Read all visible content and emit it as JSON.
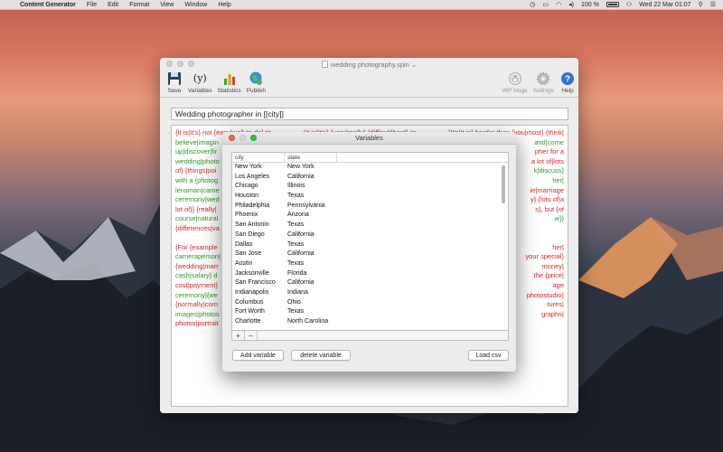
{
  "menubar": {
    "app_name": "Content Generator",
    "items": [
      "File",
      "Edit",
      "Format",
      "View",
      "Window",
      "Help"
    ],
    "battery": "100 %",
    "clock": "Wed 22 Mar  01:07"
  },
  "main_window": {
    "title": "wedding photography.spin",
    "toolbar": {
      "save": "Save",
      "variables_icon": "(y)",
      "variables": "Variables",
      "statistics": "Statistics",
      "publish": "Publish",
      "wp_blogs": "WP blogs",
      "settings": "Settings",
      "help": "Help"
    },
    "title_field_value": "Wedding photographer in [[city]]",
    "editor_lines": [
      [
        [
          "{It is|It's} not {easy|well-to-do} to",
          "r"
        ],
        [
          "(It is|It's} {very|really} {difficult|hard} to",
          "r"
        ],
        [
          "{It's|It is} harder than {you|most} {think|",
          "r"
        ]
      ],
      [
        [
          "believe|imagin",
          "g"
        ],
        [
          "",
          ""
        ],
        [
          "and|come",
          "g"
        ]
      ],
      [
        [
          "up|discover|fir",
          "g"
        ],
        [
          "",
          ""
        ],
        [
          "pher for a",
          "r"
        ]
      ],
      [
        [
          "wedding|photo",
          "g"
        ],
        [
          "",
          ""
        ],
        [
          "a lot of|lots",
          "r"
        ]
      ],
      [
        [
          "of} {things|poi",
          "r"
        ],
        [
          "",
          ""
        ],
        [
          "k|discuss}",
          "g"
        ]
      ],
      [
        [
          "with a {photog",
          "g"
        ],
        [
          "",
          ""
        ],
        [
          "her|",
          "g"
        ]
      ],
      [
        [
          "lensman|came",
          "g"
        ],
        [
          "",
          ""
        ],
        [
          "ie|marriage",
          "r"
        ]
      ],
      [
        [
          "ceremony|wed",
          "g"
        ],
        [
          "",
          ""
        ],
        [
          "y} {lots of|a",
          "r"
        ]
      ],
      [
        [
          "lot of}} {really|",
          "r"
        ],
        [
          "",
          ""
        ],
        [
          "s}, but {of",
          "r"
        ]
      ],
      [
        [
          "course|natural",
          "g"
        ],
        [
          "",
          ""
        ],
        [
          "w}}",
          "g"
        ]
      ],
      [
        [
          "{differences|va",
          "r"
        ],
        [
          "",
          ""
        ],
        [
          "",
          ""
        ]
      ]
    ],
    "editor_lines_2": [
      [
        [
          "{For {example",
          "r"
        ],
        [
          "",
          ""
        ],
        [
          "her|",
          "r"
        ]
      ],
      [
        [
          "cameraperson|",
          "g"
        ],
        [
          "",
          ""
        ],
        [
          "your special}",
          "r"
        ]
      ],
      [
        [
          "{wedding|marr",
          "r"
        ],
        [
          "",
          ""
        ],
        [
          "money|",
          "r"
        ]
      ],
      [
        [
          "cash|salary} d",
          "g"
        ],
        [
          "",
          ""
        ],
        [
          "the {price|",
          "r"
        ]
      ],
      [
        [
          "cost|payment}",
          "r"
        ],
        [
          "",
          ""
        ],
        [
          "age",
          "r"
        ]
      ],
      [
        [
          "ceremony|{we",
          "g"
        ],
        [
          "",
          ""
        ],
        [
          "photostudio}",
          "r"
        ]
      ],
      [
        [
          "{normally|com",
          "r"
        ],
        [
          "",
          ""
        ],
        [
          "tures|",
          "r"
        ]
      ],
      [
        [
          "images|photos",
          "g"
        ],
        [
          "",
          ""
        ],
        [
          "graphs|",
          "r"
        ]
      ],
      [
        [
          "photos|portrait",
          "r"
        ],
        [
          "",
          ""
        ],
        [
          "",
          ""
        ]
      ]
    ]
  },
  "variables_window": {
    "title": "Variables",
    "columns": [
      "city",
      "state"
    ],
    "rows": [
      [
        "New York",
        "New York"
      ],
      [
        "Los Angeles",
        "California"
      ],
      [
        "Chicago",
        "Illinois"
      ],
      [
        "Houston",
        "Texas"
      ],
      [
        "Philadelphia",
        "Pennsylvania"
      ],
      [
        "Phoenix",
        "Arizona"
      ],
      [
        "San Antonio",
        "Texas"
      ],
      [
        "San Diego",
        "California"
      ],
      [
        "Dallas",
        "Texas"
      ],
      [
        "San Jose",
        "California"
      ],
      [
        "Austin",
        "Texas"
      ],
      [
        "Jacksonville",
        "Florida"
      ],
      [
        "San Francisco",
        "California"
      ],
      [
        "Indianapolis",
        "Indiana"
      ],
      [
        "Columbus",
        "Ohio"
      ],
      [
        "Fort Worth",
        "Texas"
      ],
      [
        "Charlotte",
        "North Carolina"
      ]
    ],
    "plus": "+",
    "minus": "–",
    "add_variable": "Add variable",
    "delete_variable": "delete variable",
    "load_csv": "Load csv"
  },
  "colors": {
    "spin_red": "#d8262a",
    "spin_green": "#2a9a2a",
    "close": "#fc5f57",
    "zoom": "#2bc840"
  }
}
